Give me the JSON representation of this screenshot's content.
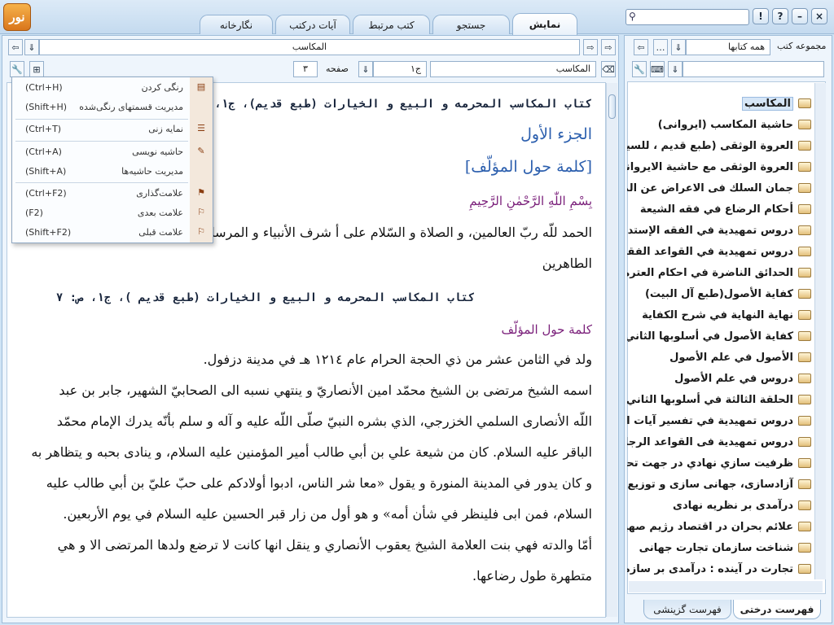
{
  "app": {
    "logo_text": "نور"
  },
  "tabs": [
    {
      "label": "نمایش"
    },
    {
      "label": "جستجو"
    },
    {
      "label": "کتب مرتبط"
    },
    {
      "label": "آیات درکتب"
    },
    {
      "label": "نگارخانه"
    }
  ],
  "window_buttons": {
    "close": "×",
    "minimize": "–",
    "help": "?",
    "info": "!"
  },
  "search": {
    "placeholder": "",
    "value": ""
  },
  "nav": {
    "book_title_value": "المكاسب",
    "volume_value": "ج١",
    "page_label": "صفحه",
    "page_value": "٣",
    "search_value": "المكاسب"
  },
  "menu": {
    "items": [
      {
        "label": "رنگی کردن",
        "shortcut": "(Ctrl+H)",
        "icon": "highlight-icon"
      },
      {
        "label": "مدیریت قسمتهای رنگی‌شده",
        "shortcut": "(Shift+H)",
        "icon": ""
      },
      {
        "label": "نمایه زنی",
        "shortcut": "(Ctrl+T)",
        "icon": "index-icon"
      },
      {
        "label": "حاشیه نویسی",
        "shortcut": "(Ctrl+A)",
        "icon": "note-icon"
      },
      {
        "label": "مدیریت حاشیه‌ها",
        "shortcut": "(Shift+A)",
        "icon": ""
      },
      {
        "label": "علامت‌گذاری",
        "shortcut": "(Ctrl+F2)",
        "icon": "bookmark-icon"
      },
      {
        "label": "علامت بعدی",
        "shortcut": "(F2)",
        "icon": "next-bookmark-icon"
      },
      {
        "label": "علامت قبلی",
        "shortcut": "(Shift+F2)",
        "icon": "prev-bookmark-icon"
      }
    ]
  },
  "content": {
    "header1": "كتاب المكاسب المحرمه و البيع و الخيارات (طبع قديم)، ج١، ص: ٣",
    "part": "الجزء الأول",
    "section": "[كلمة حول المؤلّف]",
    "basmala": "بِسْمِ اللّٰهِ الرَّحْمٰنِ الرَّحِيمِ",
    "p1a": "الحمد للّه ربّ العالمين، و الصلاة و السّلام على أ شرف الأنبياء و المرسلين محمد و آله",
    "p1b": "الطاهرين",
    "header2": "كتاب المكاسب المحرمه و البيع و الخيارات (طبع قديم )، ج١، ص: ٧",
    "subtitle": "كلمة حول المؤلّف",
    "l1": "ولد في الثامن عشر من ذي الحجة الحرام عام ١٢١٤ هـ في مدينة دزفول.",
    "l2": "اسمه الشيخ مرتضى بن الشيخ محمّد امين الأنصاريّ و ينتهي نسبه الى الصحابيّ الشهير، جابر بن عبد",
    "l3": "اللّه الأنصارى السلمي الخزرجي، الذي بشره النبيّ صلّى اللّه عليه و آله و سلم بأنّه يدرك الإمام محمّد",
    "l4": "الباقر عليه السلام. كان من شيعة علي بن أبي طالب أمير المؤمنين عليه السلام، و ينادى بحبه و يتظاهر به",
    "l5": "و كان يدور في المدينة المنورة و يقول «معا شر الناس، ادبوا أولادكم على حبّ عليّ بن أبي طالب عليه",
    "l6": "السلام، فمن ابى فلينظر في شأن أمه» و هو أول من زار قبر الحسين عليه السلام في يوم الأربعين.",
    "l7": "أمّا والدته فهي بنت العلامة الشيخ يعقوب الأنصاري و ينقل انها كانت لا ترضع ولدها المرتضى الا و هي",
    "l8": "متطهرة طول رضاعها."
  },
  "sidebar": {
    "collection_label": "مجموعه كتب",
    "collection_value": "همه كتابها",
    "filter_value": "",
    "books": [
      "المكاسب",
      "حاشية المكاسب (ايروانى)",
      "العروة الوثقى (طبع قديم ، للسيد ا",
      "العروة الوثقى مع حاشية الايرواني",
      "جمان السلك فى الاعراض عن الملك",
      "أحكام الرضاع في فقه الشيعة",
      "دروس تمهيدية في الفقه الإستدلالي",
      "دروس تمهيدية في القواعد الفقهية",
      "الحدائق الناضرة في احكام العترة ا",
      "كفاية الأصول(طبع آل البيت)",
      "نهاية النهاية في شرح الكفاية",
      "كفاية الأصول في أسلوبها الثاني",
      "الأصول في علم الأصول",
      "دروس في علم الأصول",
      "الحلقة الثالثة في أسلوبها الثاني",
      "دروس تمهيدية في تفسير آيات الأ",
      "دروس تمهيدية فى القواعد الرجالية",
      "ظرفيت سازي نهادي در جهت تحقق",
      "آزادسازی، جهانی سازی و توزیع د",
      "درآمدی بر نظریه نهادی",
      "علائم بحران در اقتصاد رژیم صهیو",
      "شناخت سازمان تجارت جهانی",
      "تجارت در آینده : درآمدی بر سازما"
    ],
    "bottom_tabs": [
      "فهرست درختی",
      "فهرست گزینشی"
    ]
  }
}
